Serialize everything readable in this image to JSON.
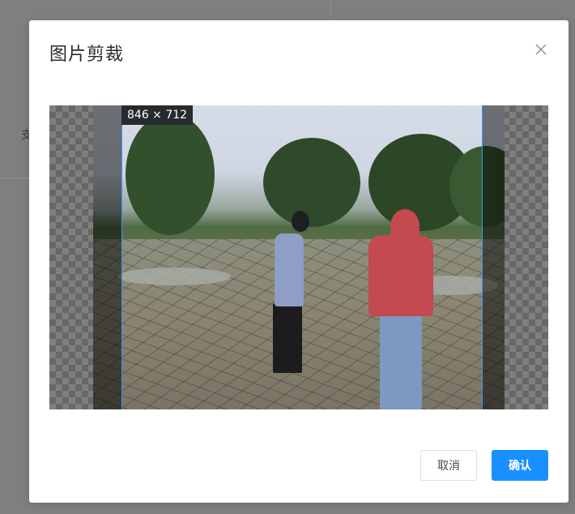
{
  "background": {
    "partial_text": "支"
  },
  "dialog": {
    "title": "图片剪裁",
    "close_icon": "close-icon"
  },
  "cropper": {
    "size_label": "846 × 712",
    "accent_color": "#3399ff"
  },
  "footer": {
    "cancel_label": "取消",
    "confirm_label": "确认",
    "confirm_color": "#1890ff"
  }
}
